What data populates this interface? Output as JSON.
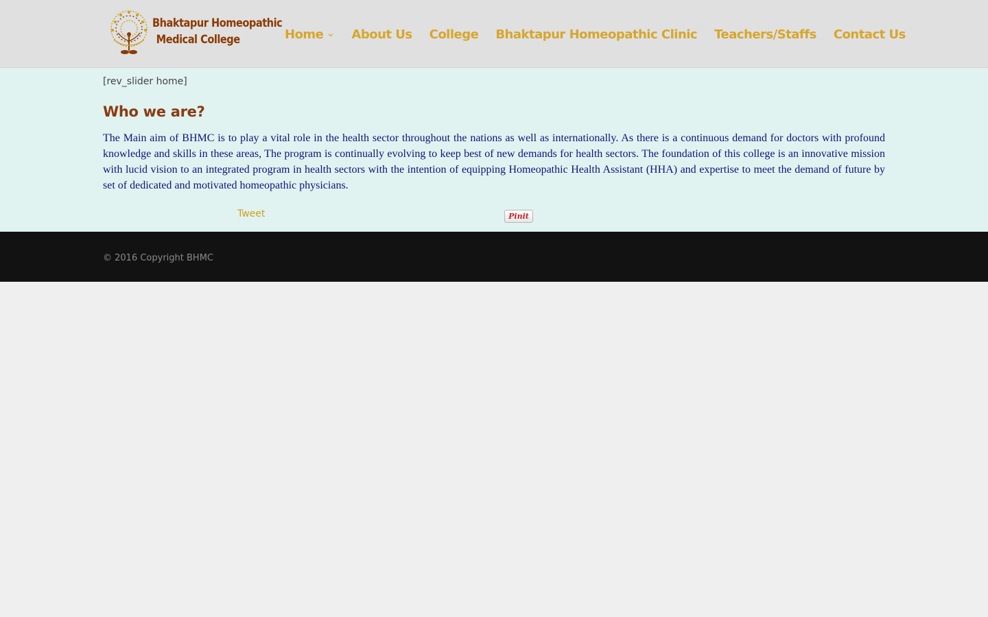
{
  "header": {
    "logo": {
      "line1": "Bhaktapur Homeopathic",
      "line2": "Medical College"
    },
    "nav": [
      {
        "label": "Home"
      },
      {
        "label": "About Us"
      },
      {
        "label": "College"
      },
      {
        "label": "Bhaktapur Homeopathic Clinic"
      },
      {
        "label": "Teachers/Staffs"
      },
      {
        "label": "Contact Us"
      }
    ]
  },
  "main": {
    "shortcode": "[rev_slider home]",
    "heading": "Who we are?",
    "paragraph": "The Main aim of BHMC is to play a vital role in the health sector throughout the nations as well as internationally. As there is a continuous demand for doctors with profound knowledge and skills in these areas, The program is continually evolving to keep best of new demands for health sectors. The foundation of this college is an innovative mission with lucid vision to an integrated program in health sectors with the intention of equipping Homeopathic Health Assistant (HHA) and expertise to meet the demand of future by set of dedicated and motivated homeopathic physicians.",
    "share": {
      "tweet_label": "Tweet",
      "pinit_label": "Pinit"
    }
  },
  "footer": {
    "copyright": "© 2016 Copyright BHMC"
  },
  "colors": {
    "header_bg": "#e0e0e0",
    "nav_text": "#d6a62c",
    "content_bg": "#e0f3f1",
    "heading": "#8b3a12",
    "paragraph": "#14107a",
    "footer_bg": "#121212",
    "footer_text": "#8a8a8a",
    "pinterest_red": "#cb2027"
  },
  "icons": {
    "logo_emblem": "tree-icon",
    "home_submenu": "chevron-down-icon"
  }
}
